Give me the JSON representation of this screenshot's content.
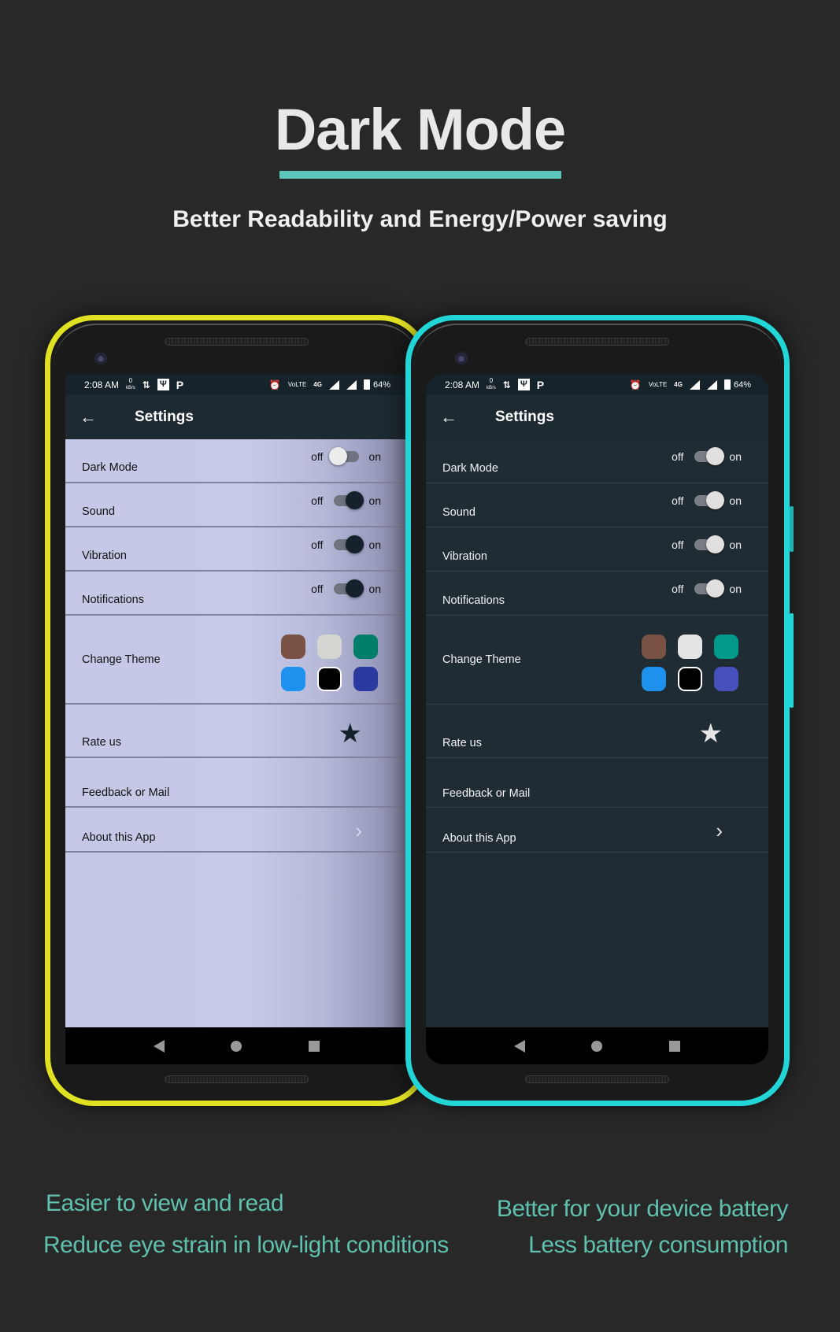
{
  "header": {
    "title": "Dark Mode",
    "subtitle": "Better Readability and Energy/Power saving",
    "accent_color": "#5bc6b9"
  },
  "phones": {
    "light": {
      "frame_color": "#e1e124",
      "status_bar": {
        "time": "2:08 AM",
        "speed": "0",
        "speed_unit": "kB/s",
        "battery": "64%",
        "network": "4G"
      },
      "toolbar": {
        "back_icon": "arrow-left",
        "title": "Settings"
      },
      "settings": [
        {
          "label": "Dark Mode",
          "off_label": "off",
          "on_label": "on",
          "enabled": false
        },
        {
          "label": "Sound",
          "off_label": "off",
          "on_label": "on",
          "enabled": true
        },
        {
          "label": "Vibration",
          "off_label": "off",
          "on_label": "on",
          "enabled": true
        },
        {
          "label": "Notifications",
          "off_label": "off",
          "on_label": "on",
          "enabled": true
        }
      ],
      "theme": {
        "label": "Change Theme",
        "swatches": [
          "#7a5244",
          "#d5d6d2",
          "#007e6b",
          "#1e90ee",
          "#000000",
          "#2b3a9e"
        ],
        "selected_index": 4
      },
      "rate": {
        "label": "Rate us",
        "icon": "smiling-star-icon"
      },
      "feedback": {
        "label": "Feedback or Mail",
        "icon": "mail-icon"
      },
      "about": {
        "label": "About this App",
        "icon": "chevron-right-icon"
      },
      "knob_on_color": "#14212a",
      "knob_off_color": "#ececec"
    },
    "dark": {
      "frame_color": "#22d6d8",
      "status_bar": {
        "time": "2:08 AM",
        "speed": "0",
        "speed_unit": "kB/s",
        "battery": "64%",
        "network": "4G"
      },
      "toolbar": {
        "back_icon": "arrow-left",
        "title": "Settings"
      },
      "settings": [
        {
          "label": "Dark Mode",
          "off_label": "off",
          "on_label": "on",
          "enabled": true
        },
        {
          "label": "Sound",
          "off_label": "off",
          "on_label": "on",
          "enabled": true
        },
        {
          "label": "Vibration",
          "off_label": "off",
          "on_label": "on",
          "enabled": true
        },
        {
          "label": "Notifications",
          "off_label": "off",
          "on_label": "on",
          "enabled": true
        }
      ],
      "theme": {
        "label": "Change Theme",
        "swatches": [
          "#7a5244",
          "#e4e4e4",
          "#00998a",
          "#1e90ee",
          "#000000",
          "#4550bd"
        ],
        "selected_index": 4
      },
      "rate": {
        "label": "Rate us",
        "icon": "smiling-star-icon"
      },
      "feedback": {
        "label": "Feedback or Mail",
        "icon": "mail-icon"
      },
      "about": {
        "label": "About this App",
        "icon": "chevron-right-icon"
      },
      "knob_on_color": "#e0e0e0",
      "knob_off_color": "#e0e0e0"
    }
  },
  "benefits": {
    "left": [
      "Easier to view and read",
      "Reduce eye strain in low-light conditions"
    ],
    "right": [
      "Better for your device battery",
      "Less battery consumption"
    ],
    "color": "#5fc1ad"
  }
}
